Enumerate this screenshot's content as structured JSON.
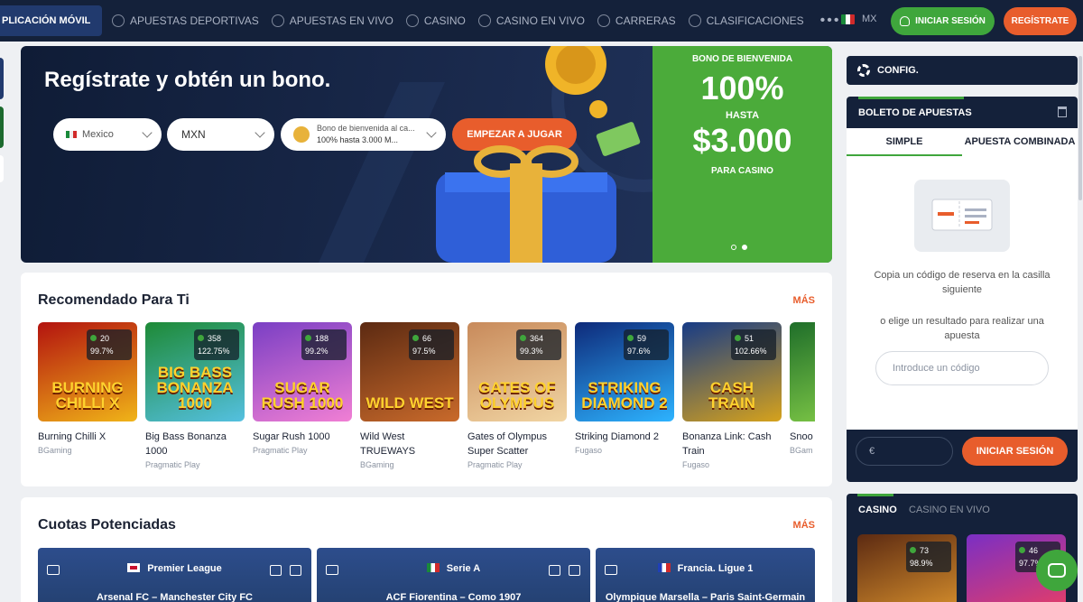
{
  "topnav": {
    "app_label": "PLICACIÓN MÓVIL",
    "items": [
      {
        "label": "APUESTAS DEPORTIVAS",
        "icon": "soccer-ball-icon"
      },
      {
        "label": "APUESTAS EN VIVO",
        "icon": "live-icon"
      },
      {
        "label": "CASINO",
        "icon": "casino-chip-icon"
      },
      {
        "label": "CASINO EN VIVO",
        "icon": "live-casino-icon"
      },
      {
        "label": "CARRERAS",
        "icon": "horse-icon"
      },
      {
        "label": "CLASIFICACIONES",
        "icon": "trophy-icon"
      }
    ],
    "more": "•••",
    "lang": "MX",
    "login": "INICIAR SESIÓN",
    "register": "REGÍSTRATE"
  },
  "hero": {
    "title": "Regístrate y obtén un bono.",
    "country": "Mexico",
    "currency": "MXN",
    "bonus_line1": "Bono de bienvenida al ca...",
    "bonus_line2": "100% hasta 3.000 M...",
    "cta": "EMPEZAR A JUGAR",
    "panel": {
      "line1": "BONO DE BIENVENIDA",
      "line2": "100%",
      "line3": "HASTA",
      "line4": "$3.000",
      "line5": "PARA CASINO"
    }
  },
  "recommended": {
    "title": "Recomendado Para Ti",
    "more": "MÁS",
    "games": [
      {
        "thumb": "BURNING CHILLI X",
        "count": "20",
        "rtp": "99.7%",
        "name": "Burning Chilli X",
        "name2": "",
        "provider": "BGaming",
        "bg1": "#b3130f",
        "bg2": "#f0b418"
      },
      {
        "thumb": "BIG BASS BONANZA 1000",
        "count": "358",
        "rtp": "122.75%",
        "name": "Big Bass Bonanza",
        "name2": "1000",
        "provider": "Pragmatic Play",
        "bg1": "#1e8a36",
        "bg2": "#54c0e0"
      },
      {
        "thumb": "SUGAR RUSH 1000",
        "count": "188",
        "rtp": "99.2%",
        "name": "Sugar Rush 1000",
        "name2": "",
        "provider": "Pragmatic Play",
        "bg1": "#7a3fc4",
        "bg2": "#f17fd4"
      },
      {
        "thumb": "WILD WEST",
        "count": "66",
        "rtp": "97.5%",
        "name": "Wild West",
        "name2": "TRUEWAYS",
        "provider": "BGaming",
        "bg1": "#5c2a12",
        "bg2": "#c96a2b"
      },
      {
        "thumb": "GATES OF OLYMPUS",
        "count": "364",
        "rtp": "99.3%",
        "name": "Gates of Olympus",
        "name2": "Super Scatter",
        "provider": "Pragmatic Play",
        "bg1": "#c88a5b",
        "bg2": "#f1d5a3"
      },
      {
        "thumb": "STRIKING DIAMOND 2",
        "count": "59",
        "rtp": "97.6%",
        "name": "Striking Diamond 2",
        "name2": "",
        "provider": "Fugaso",
        "bg1": "#0e2a7a",
        "bg2": "#2db3ff"
      },
      {
        "thumb": "CASH TRAIN",
        "count": "51",
        "rtp": "102.66%",
        "name": "Bonanza Link: Cash",
        "name2": "Train",
        "provider": "Fugaso",
        "bg1": "#173b86",
        "bg2": "#d6a21c"
      },
      {
        "thumb": "",
        "count": "",
        "rtp": "",
        "name": "Snoo",
        "name2": "",
        "provider": "BGam",
        "bg1": "#1f6e2a",
        "bg2": "#8bd44a"
      }
    ]
  },
  "boosted": {
    "title": "Cuotas Potenciadas",
    "more": "MÁS",
    "matches": [
      {
        "league": "Premier League",
        "match": "Arsenal FC – Manchester City FC"
      },
      {
        "league": "Serie A",
        "match": "ACF Fiorentina – Como 1907"
      },
      {
        "league": "Francia. Ligue 1",
        "match": "Olympique Marsella – Paris Saint-Germain"
      }
    ]
  },
  "sidebar": {
    "config": "CONFIG.",
    "slip_title": "BOLETO DE APUESTAS",
    "tab_simple": "SIMPLE",
    "tab_combo": "APUESTA COMBINADA",
    "msg1": "Copia un código de reserva en la casilla siguiente",
    "msg2": "o elige un resultado para realizar una apuesta",
    "code_placeholder": "Introduce un código",
    "currency_symbol": "€",
    "login": "INICIAR SESIÓN",
    "casino_tab": "CASINO",
    "live_casino_tab": "CASINO EN VIVO",
    "casino_games": [
      {
        "count": "73",
        "rtp": "98.9%"
      },
      {
        "count": "46",
        "rtp": "97.7%"
      }
    ]
  },
  "colors": {
    "green": "#3fa63c",
    "orange": "#e85d2c",
    "navy": "#14213a"
  }
}
